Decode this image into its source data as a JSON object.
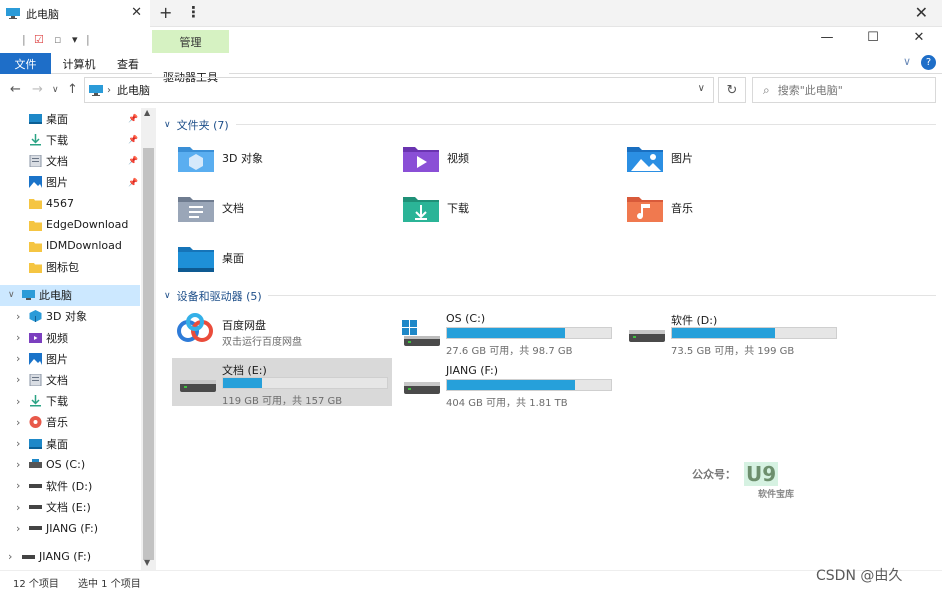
{
  "window": {
    "tab_title": "此电脑",
    "tab_add": "+",
    "tab_more": "⋮",
    "close": "✕"
  },
  "ribbon": {
    "context_group": "管理",
    "tabs": {
      "file": "文件",
      "computer": "计算机",
      "view": "查看",
      "drive_tools": "驱动器工具"
    },
    "help": "?",
    "expand": "∨"
  },
  "window_controls": {
    "minimize": "—",
    "maximize": "☐",
    "close": "✕"
  },
  "address": {
    "back": "←",
    "forward": "→",
    "recent": "∨",
    "up": "↑",
    "path": "此电脑",
    "dropdown": "∨",
    "refresh": "↻",
    "search_placeholder": "搜索\"此电脑\""
  },
  "sidebar": {
    "quick": [
      {
        "label": "桌面",
        "icon": "desktop-folder-icon",
        "pinned": true
      },
      {
        "label": "下载",
        "icon": "download-folder-icon",
        "pinned": true
      },
      {
        "label": "文档",
        "icon": "documents-folder-icon",
        "pinned": true
      },
      {
        "label": "图片",
        "icon": "pictures-folder-icon",
        "pinned": true
      },
      {
        "label": "4567",
        "icon": "folder-icon",
        "pinned": false
      },
      {
        "label": "EdgeDownload",
        "icon": "folder-icon",
        "pinned": false
      },
      {
        "label": "IDMDownload",
        "icon": "folder-icon",
        "pinned": false
      },
      {
        "label": "图标包",
        "icon": "folder-icon",
        "pinned": false
      }
    ],
    "this_pc": "此电脑",
    "pc_children": [
      {
        "label": "3D 对象",
        "icon": "3d-objects-icon"
      },
      {
        "label": "视频",
        "icon": "videos-folder-icon"
      },
      {
        "label": "图片",
        "icon": "pictures-folder-icon"
      },
      {
        "label": "文档",
        "icon": "documents-folder-icon"
      },
      {
        "label": "下载",
        "icon": "download-folder-icon"
      },
      {
        "label": "音乐",
        "icon": "music-folder-icon"
      },
      {
        "label": "桌面",
        "icon": "desktop-folder-icon"
      },
      {
        "label": "OS (C:)",
        "icon": "windows-drive-icon"
      },
      {
        "label": "软件 (D:)",
        "icon": "drive-icon"
      },
      {
        "label": "文档 (E:)",
        "icon": "drive-icon"
      },
      {
        "label": "JIANG (F:)",
        "icon": "drive-icon"
      }
    ],
    "extra": "JIANG (F:)"
  },
  "main": {
    "folders_header": "文件夹 (7)",
    "folders": [
      {
        "label": "3D 对象",
        "icon": "3d-objects-icon"
      },
      {
        "label": "视频",
        "icon": "videos-folder-icon"
      },
      {
        "label": "图片",
        "icon": "pictures-folder-icon"
      },
      {
        "label": "文档",
        "icon": "documents-folder-icon"
      },
      {
        "label": "下载",
        "icon": "download-folder-icon"
      },
      {
        "label": "音乐",
        "icon": "music-folder-icon"
      },
      {
        "label": "桌面",
        "icon": "desktop-folder-icon"
      }
    ],
    "devices_header": "设备和驱动器 (5)",
    "baidu": {
      "name": "百度网盘",
      "desc": "双击运行百度网盘"
    },
    "drives": [
      {
        "name": "OS (C:)",
        "free": "27.6 GB 可用，共 98.7 GB",
        "used_fraction": 0.72,
        "icon": "windows-drive-icon"
      },
      {
        "name": "软件 (D:)",
        "free": "73.5 GB 可用，共 199 GB",
        "used_fraction": 0.63,
        "icon": "drive-icon"
      },
      {
        "name": "文档 (E:)",
        "free": "119 GB 可用，共 157 GB",
        "used_fraction": 0.24,
        "icon": "drive-icon"
      },
      {
        "name": "JIANG (F:)",
        "free": "404 GB 可用，共 1.81 TB",
        "used_fraction": 0.78,
        "icon": "drive-icon"
      }
    ]
  },
  "status": {
    "count": "12 个项目",
    "selected": "选中 1 个项目"
  },
  "watermark": {
    "prefix": "公众号：",
    "logo": "U9",
    "sub": "软件宝库",
    "csdn": "CSDN @由久"
  },
  "colors": {
    "accent": "#1e6ec8",
    "selection": "#cce8ff",
    "drive_fill": "#26a0da",
    "context_tab": "#d6f2c2"
  }
}
